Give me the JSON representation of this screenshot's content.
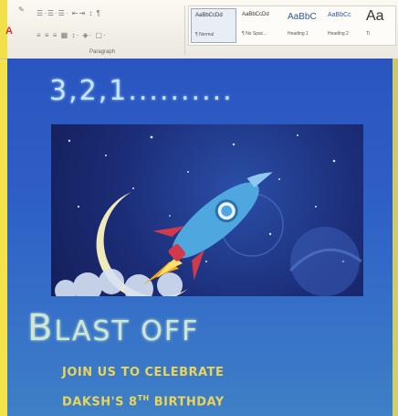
{
  "ribbon": {
    "paragraph_label": "Paragraph",
    "styles": [
      {
        "sample": "AaBbCcDd",
        "name": "¶ Normal",
        "active": true
      },
      {
        "sample": "AaBbCcDd",
        "name": "¶ No Spac...",
        "active": false
      },
      {
        "sample": "AaBbC",
        "name": "Heading 1",
        "active": false
      },
      {
        "sample": "AaBbCc",
        "name": "Heading 2",
        "active": false
      },
      {
        "sample": "Aa",
        "name": "Ti",
        "active": false
      }
    ]
  },
  "invite": {
    "countdown": "3,2,1..........",
    "blast_first": "B",
    "blast_rest": "LAST OFF",
    "line1": "JOIN US TO CELEBRATE",
    "line2_pre": "DAKSH'S 8",
    "line2_sup": "TH",
    "line2_post": " BIRTHDAY"
  },
  "colors": {
    "doc_blue": "#2e5fc6",
    "countdown": "#c9e4ff",
    "blast": "#cfe6d6",
    "celebrate_text": "#e8d55a",
    "rocket_body": "#4fa7e0",
    "rocket_fins": "#d23a4a",
    "moon": "#f0e9b8"
  }
}
